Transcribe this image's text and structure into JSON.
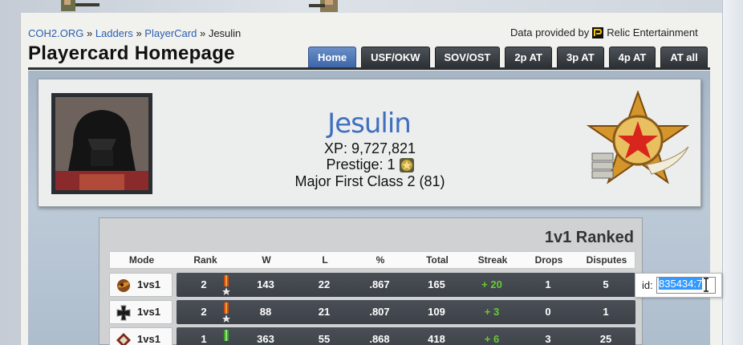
{
  "breadcrumb": {
    "items": [
      "COH2.ORG",
      "Ladders",
      "PlayerCard"
    ],
    "separator": "»",
    "current": "Jesulin"
  },
  "provider": {
    "prefix": "Data provided by",
    "name": "Relic Entertainment"
  },
  "page_title": "Playercard Homepage",
  "tabs": [
    {
      "label": "Home",
      "active": true
    },
    {
      "label": "USF/OKW",
      "active": false
    },
    {
      "label": "SOV/OST",
      "active": false
    },
    {
      "label": "2p AT",
      "active": false
    },
    {
      "label": "3p AT",
      "active": false
    },
    {
      "label": "4p AT",
      "active": false
    },
    {
      "label": "AT all",
      "active": false
    }
  ],
  "player": {
    "name": "Jesulin",
    "xp": "XP: 9,727,821",
    "prestige": "Prestige: 1",
    "rank": "Major First Class 2 (81)"
  },
  "ranked": {
    "title": "1v1 Ranked",
    "columns": [
      "Mode",
      "Rank",
      "W",
      "L",
      "%",
      "Total",
      "Streak",
      "Drops",
      "Disputes"
    ],
    "rows": [
      {
        "mode": "1vs1",
        "icon": "soviet-faction-icon",
        "rank": "2",
        "w": "143",
        "l": "22",
        "pct": ".867",
        "total": "165",
        "streak": "+ 20",
        "drops": "1",
        "disputes": "5"
      },
      {
        "mode": "1vs1",
        "icon": "wehrmacht-faction-icon",
        "rank": "2",
        "w": "88",
        "l": "21",
        "pct": ".807",
        "total": "109",
        "streak": "+ 3",
        "drops": "0",
        "disputes": "1"
      },
      {
        "mode": "1vs1",
        "icon": "okw-faction-icon",
        "rank": "1",
        "w": "363",
        "l": "55",
        "pct": ".868",
        "total": "418",
        "streak": "+ 6",
        "drops": "3",
        "disputes": "25"
      }
    ]
  },
  "id_popup": {
    "label": "id:",
    "value": "835434:7"
  },
  "colors": {
    "link": "#2a5fb0",
    "active_tab": "#4f7bc0",
    "tab": "#3a3e44",
    "streak_positive": "#66cc33",
    "player_name": "#3f6fbf"
  }
}
